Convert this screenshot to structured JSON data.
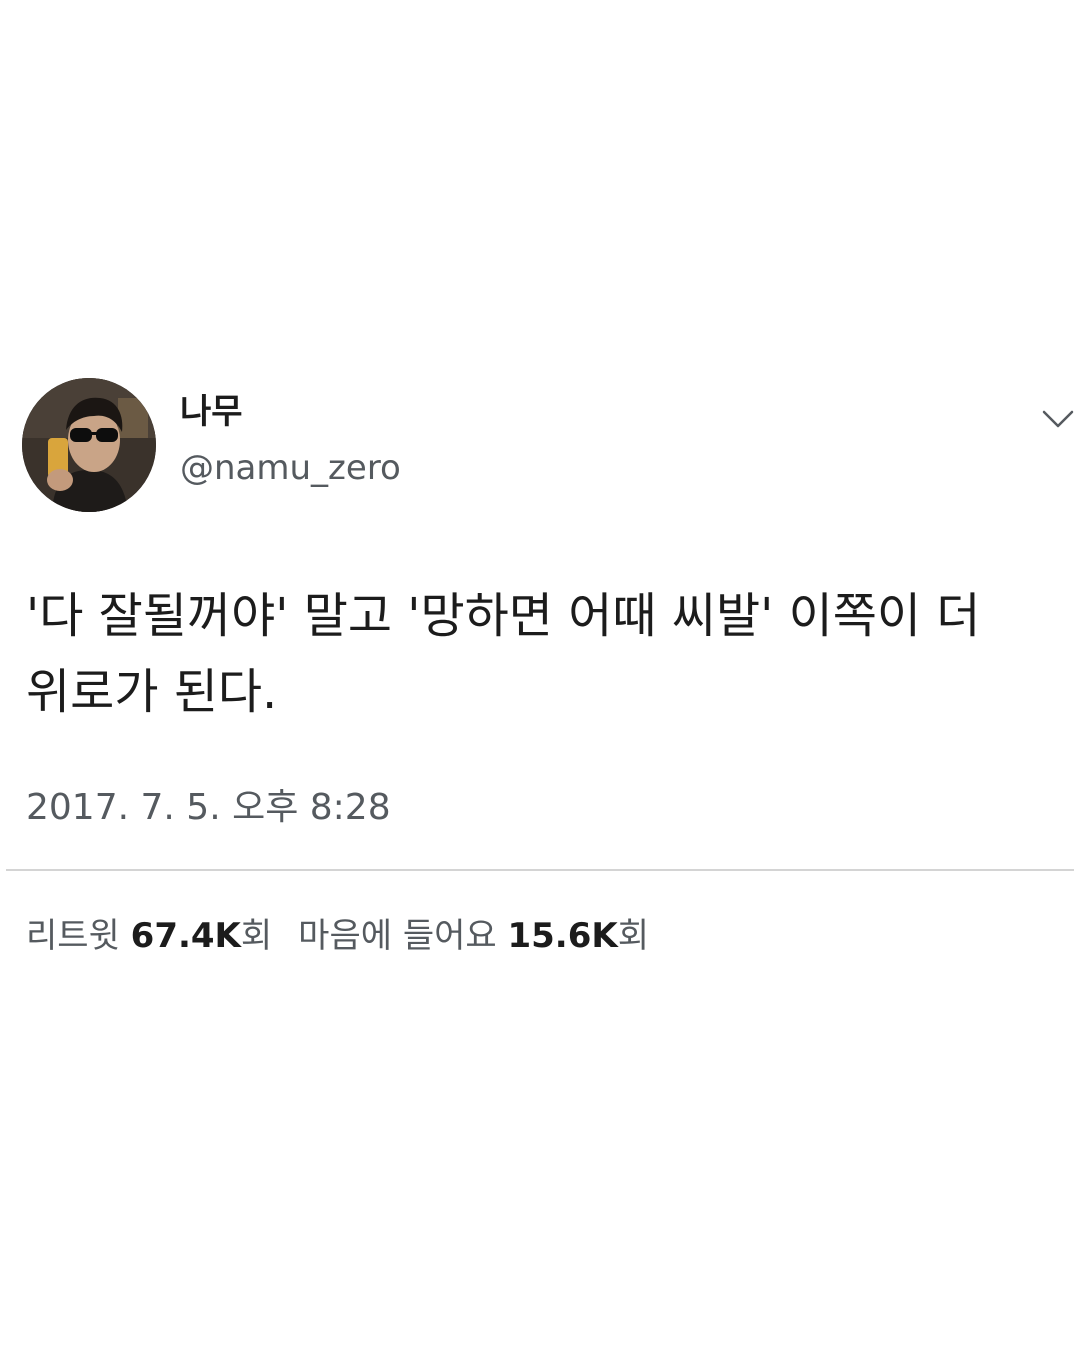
{
  "author": {
    "display_name": "나무",
    "handle": "@namu_zero"
  },
  "tweet": {
    "text": "'다 잘될꺼야' 말고 '망하면 어때 씨발' 이쪽이 더 위로가 된다.",
    "timestamp": "2017. 7. 5. 오후 8:28"
  },
  "stats": {
    "retweets": {
      "label": "리트윗",
      "count": "67.4K",
      "suffix": "회"
    },
    "likes": {
      "label": "마음에 들어요",
      "count": "15.6K",
      "suffix": "회"
    }
  },
  "icons": {
    "menu": "chevron-down-icon"
  },
  "colors": {
    "text_primary": "#1c1c1c",
    "text_secondary": "#555a5f",
    "divider": "#d4d4d4",
    "background": "#ffffff"
  }
}
